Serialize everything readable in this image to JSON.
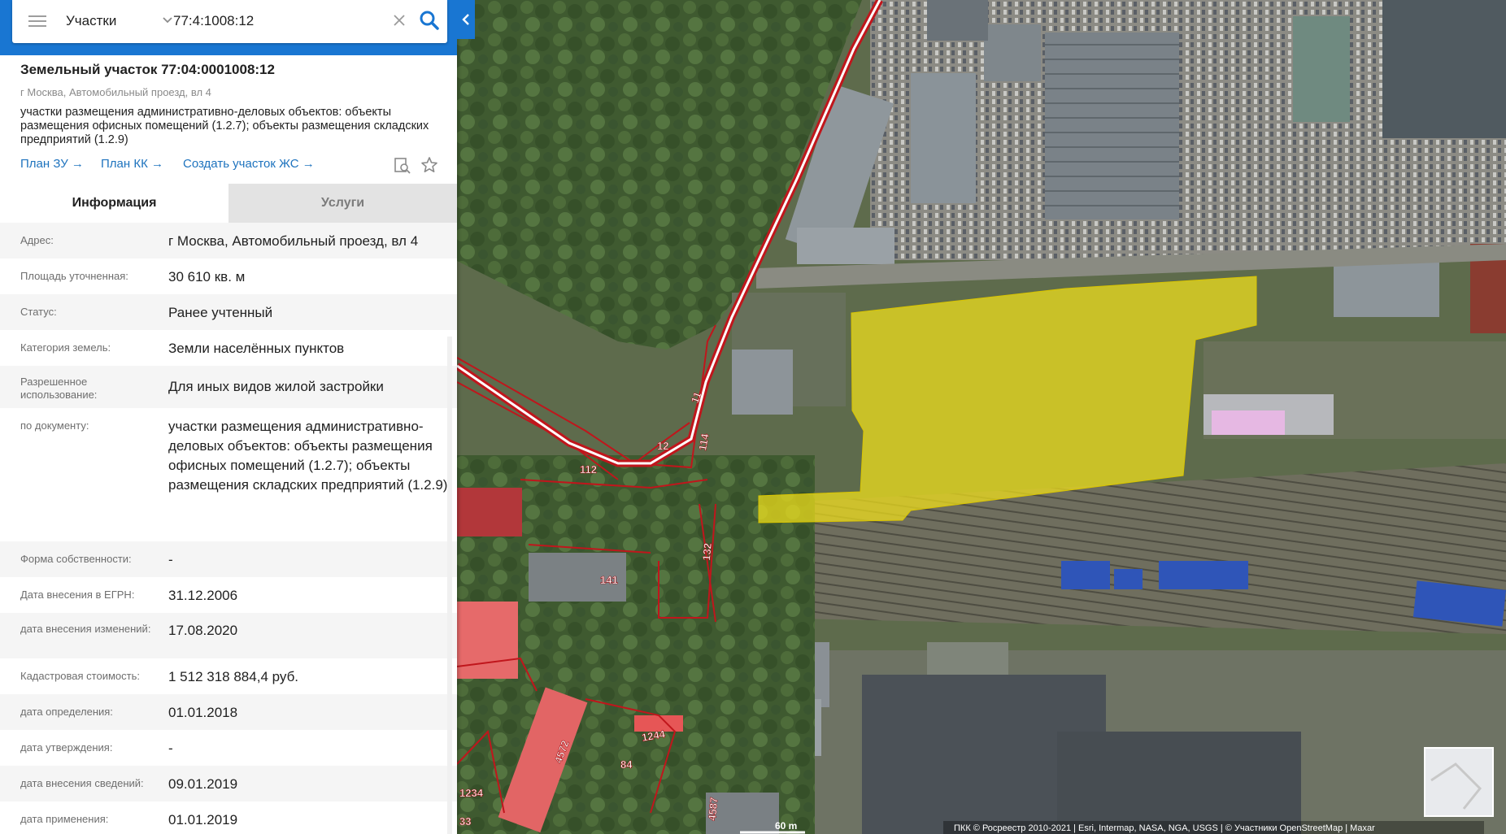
{
  "search": {
    "category": "Участки",
    "query": "77:4:1008:12"
  },
  "card": {
    "title": "Земельный участок 77:04:0001008:12",
    "address": "г Москва, Автомобильный проезд, вл 4",
    "description": "участки размещения административно-деловых объектов: объекты размещения офисных помещений (1.2.7); объекты размещения складских предприятий (1.2.9)",
    "links": {
      "plan_zu": "План ЗУ",
      "plan_kk": "План КК",
      "create_zs": "Создать участок ЖС"
    },
    "arrow": "→"
  },
  "tabs": {
    "info": "Информация",
    "services": "Услуги"
  },
  "rows": [
    {
      "label": "Адрес:",
      "value": "г Москва, Автомобильный проезд, вл 4"
    },
    {
      "label": "Площадь уточненная:",
      "value": "30 610 кв. м"
    },
    {
      "label": "Статус:",
      "value": "Ранее учтенный"
    },
    {
      "label": "Категория земель:",
      "value": "Земли населённых пунктов"
    },
    {
      "label": "Разрешенное использование:",
      "value": "Для иных видов жилой застройки"
    },
    {
      "label": "по документу:",
      "value": "участки размещения административно-деловых объектов: объекты размещения офисных помещений (1.2.7); объекты размещения складских предприятий (1.2.9)"
    },
    {
      "label": "Форма собственности:",
      "value": "-"
    },
    {
      "label": "Дата внесения в ЕГРН:",
      "value": "31.12.2006"
    },
    {
      "label": "дата внесения изменений:",
      "value": "17.08.2020"
    },
    {
      "label": "Кадастровая стоимость:",
      "value": "1 512 318 884,4 руб."
    },
    {
      "label": "дата определения:",
      "value": "01.01.2018"
    },
    {
      "label": "дата утверждения:",
      "value": "-"
    },
    {
      "label": "дата внесения сведений:",
      "value": "09.01.2019"
    },
    {
      "label": "дата применения:",
      "value": "01.01.2019"
    }
  ],
  "map": {
    "parcel_labels": [
      "11",
      "12",
      "112",
      "114",
      "132",
      "141",
      "84",
      "1244",
      "4572",
      "4587",
      "1234",
      "33"
    ],
    "scale_label": "60 m",
    "attribution": "ПКК © Росреестр 2010-2021 | Esri, Intermap, NASA, NGA, USGS | © Участники OpenStreetMap | Maxar",
    "colors": {
      "parcel_border": "#c0161c",
      "selected_parcel": "#f2e21a",
      "panel_header": "#1976d2"
    }
  },
  "icons": [
    "menu-icon",
    "chevron-down-icon",
    "clear-icon",
    "search-icon",
    "collapse-left-icon",
    "preview-icon",
    "star-icon"
  ]
}
